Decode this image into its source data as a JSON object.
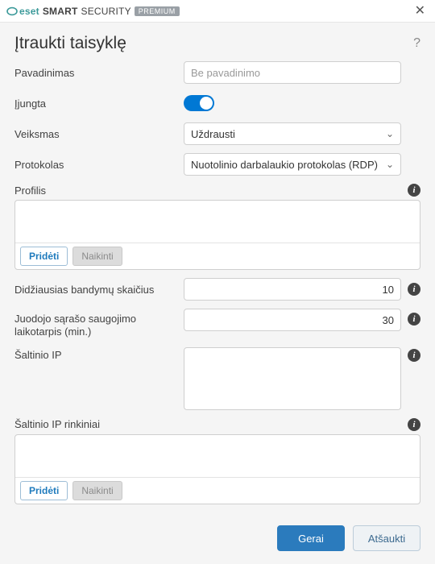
{
  "brand": {
    "eset": "eset",
    "smart": "SMART",
    "security": "SECURITY",
    "badge": "PREMIUM"
  },
  "title": "Įtraukti taisyklę",
  "labels": {
    "name": "Pavadinimas",
    "enabled": "Įjungta",
    "action": "Veiksmas",
    "protocol": "Protokolas",
    "profile": "Profilis",
    "max_attempts": "Didžiausias bandymų skaičius",
    "blacklist_period": "Juodojo sąrašo saugojimo laikotarpis (min.)",
    "source_ip": "Šaltinio IP",
    "source_ip_sets": "Šaltinio IP rinkiniai"
  },
  "fields": {
    "name_placeholder": "Be pavadinimo",
    "name_value": "",
    "enabled": true,
    "action": "Uždrausti",
    "protocol": "Nuotolinio darbalaukio protokolas (RDP)",
    "max_attempts": "10",
    "blacklist_period": "30",
    "source_ip": "",
    "profile_items": [],
    "source_ip_set_items": []
  },
  "buttons": {
    "add": "Pridėti",
    "delete": "Naikinti",
    "ok": "Gerai",
    "cancel": "Atšaukti"
  }
}
